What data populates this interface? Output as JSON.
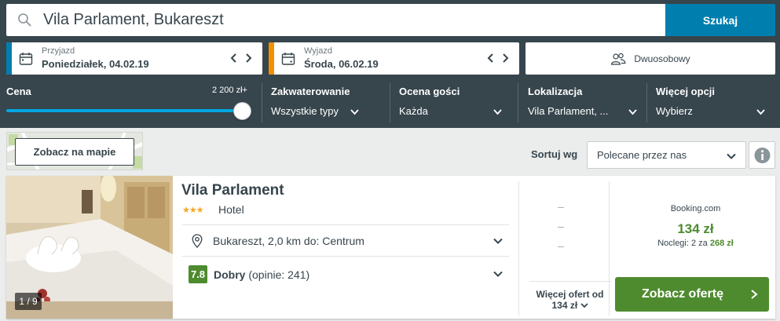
{
  "search": {
    "query": "Vila Parlament, Bukareszt",
    "button_label": "Szukaj"
  },
  "dates": {
    "checkin": {
      "label": "Przyjazd",
      "value": "Poniedziałek, 04.02.19",
      "color": "#007faf"
    },
    "checkout": {
      "label": "Wyjazd",
      "value": "Środa, 06.02.19",
      "color": "#f48f00"
    }
  },
  "room": {
    "label": "Dwuosobowy",
    "icon": "two-people-icon"
  },
  "filters": {
    "price": {
      "title": "Cena",
      "max_label": "2 200 zł+",
      "level": 1.0
    },
    "accommodation": {
      "title": "Zakwaterowanie",
      "value": "Wszystkie typy"
    },
    "guest_rating": {
      "title": "Ocena gości",
      "value": "Każda"
    },
    "location": {
      "title": "Lokalizacja",
      "value": "Vila Parlament, ..."
    },
    "more": {
      "title": "Więcej opcji",
      "value": "Wybierz"
    }
  },
  "map": {
    "button_label": "Zobacz na mapie"
  },
  "sort": {
    "label": "Sortuj wg",
    "value": "Polecane przez nas"
  },
  "result": {
    "photo_count": "1 / 9",
    "name": "Vila Parlament",
    "stars": "★★★",
    "star_count": 3,
    "type": "Hotel",
    "location": "Bukareszt, 2,0 km do: Centrum",
    "rating_score": "7.8",
    "rating_label": "Dobry",
    "rating_reviews": "(opinie: 241)",
    "more_offers_line1": "Więcej ofert od",
    "more_offers_line2": "134 zł",
    "provider": "Booking.com",
    "price": "134 zł",
    "nights_prefix": "Noclegi: 2 za",
    "nights_total": "268 zł",
    "offer_button": "Zobacz ofertę"
  },
  "colors": {
    "primary": "#007faf",
    "rating_green": "#4e8b2f",
    "header_bg": "#37454d",
    "checkout_accent": "#f48f00"
  }
}
